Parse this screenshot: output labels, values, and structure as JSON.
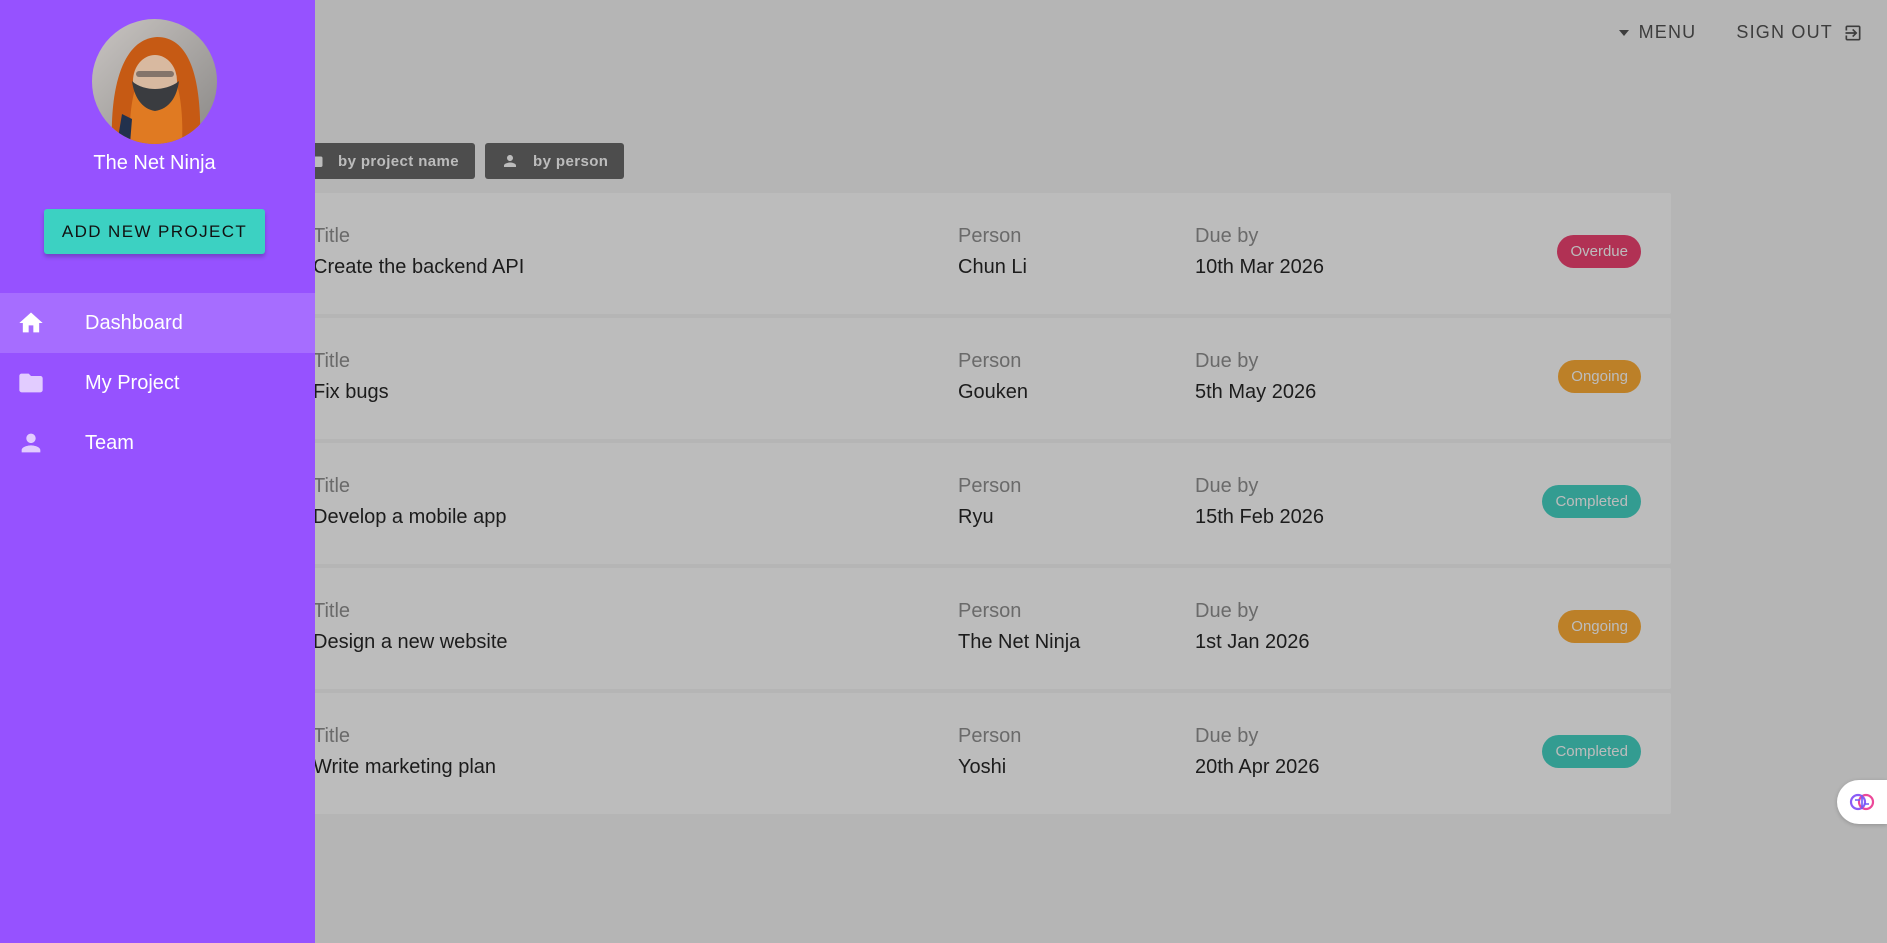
{
  "header": {
    "menu_label": "MENU",
    "signout_label": "SIGN OUT"
  },
  "filters": [
    {
      "label": "by project name",
      "icon": "folder-icon"
    },
    {
      "label": "by person",
      "icon": "person-icon"
    }
  ],
  "columns": {
    "title": "Title",
    "person": "Person",
    "due": "Due by"
  },
  "projects": [
    {
      "title": "Create the backend API",
      "person": "Chun Li",
      "due": "10th Mar 2026",
      "status": "Overdue",
      "status_color": "#f0386b"
    },
    {
      "title": "Fix bugs",
      "person": "Gouken",
      "due": "5th May 2026",
      "status": "Ongoing",
      "status_color": "#ffaa2c"
    },
    {
      "title": "Develop a mobile app",
      "person": "Ryu",
      "due": "15th Feb 2026",
      "status": "Completed",
      "status_color": "#3cd1c2"
    },
    {
      "title": "Design a new website",
      "person": "The Net Ninja",
      "due": "1st Jan 2026",
      "status": "Ongoing",
      "status_color": "#ffaa2c"
    },
    {
      "title": "Write marketing plan",
      "person": "Yoshi",
      "due": "20th Apr 2026",
      "status": "Completed",
      "status_color": "#3cd1c2"
    }
  ],
  "drawer": {
    "user_name": "The Net Ninja",
    "add_button": "ADD NEW PROJECT",
    "nav": [
      {
        "label": "Dashboard",
        "icon": "home-icon",
        "active": true
      },
      {
        "label": "My Project",
        "icon": "folder-icon",
        "active": false
      },
      {
        "label": "Team",
        "icon": "person-icon",
        "active": false
      }
    ]
  },
  "colors": {
    "drawer": "#9652ff",
    "accent": "#3cd1c2",
    "overdue": "#f0386b",
    "ongoing": "#ffaa2c",
    "completed": "#3cd1c2"
  }
}
